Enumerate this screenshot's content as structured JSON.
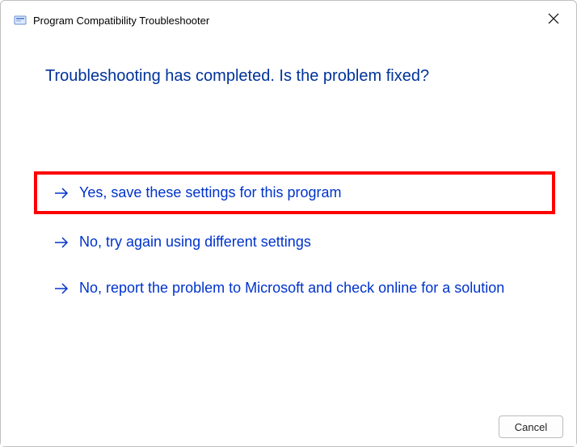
{
  "window": {
    "title": "Program Compatibility Troubleshooter"
  },
  "main": {
    "heading": "Troubleshooting has completed.  Is the problem fixed?"
  },
  "options": [
    {
      "label": "Yes, save these settings for this program"
    },
    {
      "label": "No, try again using different settings"
    },
    {
      "label": "No, report the problem to Microsoft and check online for a solution"
    }
  ],
  "footer": {
    "cancel_label": "Cancel"
  }
}
